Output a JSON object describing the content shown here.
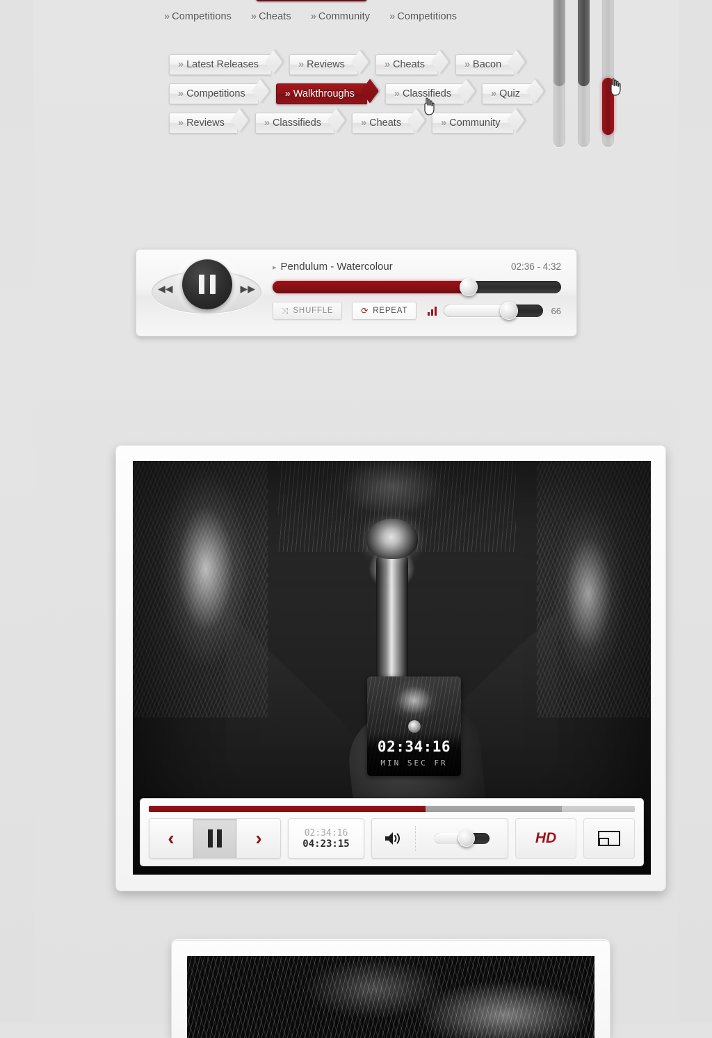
{
  "nav": {
    "breadcrumbs": [
      {
        "chev": "»",
        "label": "Competitions"
      },
      {
        "chev": "»",
        "label": "Cheats"
      },
      {
        "chev": "»",
        "label": "Community"
      },
      {
        "chev": "»",
        "label": "Competitions"
      }
    ],
    "tab_rows": [
      [
        {
          "chev": "»",
          "label": "Latest Releases",
          "active": false
        },
        {
          "chev": "»",
          "label": "Reviews",
          "active": false
        },
        {
          "chev": "»",
          "label": "Cheats",
          "active": false
        },
        {
          "chev": "»",
          "label": "Bacon",
          "active": false
        }
      ],
      [
        {
          "chev": "»",
          "label": "Competitions",
          "active": false
        },
        {
          "chev": "»",
          "label": "Walkthroughs",
          "active": true
        },
        {
          "chev": "»",
          "label": "Classifieds",
          "active": false
        },
        {
          "chev": "»",
          "label": "Quiz",
          "active": false
        }
      ],
      [
        {
          "chev": "»",
          "label": "Reviews",
          "active": false
        },
        {
          "chev": "»",
          "label": "Classifieds",
          "active": false
        },
        {
          "chev": "»",
          "label": "Cheats",
          "active": false
        },
        {
          "chev": "»",
          "label": "Community",
          "active": false
        }
      ]
    ]
  },
  "sliders": {
    "accent_color": "#9c1419",
    "items": [
      {
        "name": "slider-light",
        "fill_percent": 62,
        "style": "light"
      },
      {
        "name": "slider-dark",
        "fill_percent": 62,
        "style": "dark"
      },
      {
        "name": "slider-red",
        "fill_percent": 38,
        "style": "red"
      }
    ]
  },
  "audio_player": {
    "track_title": "Pendulum - Watercolour",
    "title_marker": "▸",
    "time_display": "02:36 - 4:32",
    "progress_percent": 68,
    "prev_icon": "◀◀",
    "next_icon": "▶▶",
    "state": "paused",
    "shuffle": {
      "label": "SHUFFLE",
      "icon": "⤨",
      "enabled": false
    },
    "repeat": {
      "label": "REPEAT",
      "icon": "⟳",
      "enabled": true
    },
    "volume_value": "66",
    "volume_percent": 66
  },
  "video_player": {
    "scrub_preview": {
      "timecode": "02:34:16",
      "units": "MIN SEC FR"
    },
    "progress": {
      "played_percent": 57,
      "buffered_percent": 85
    },
    "controls": {
      "prev_label": "‹",
      "pause_state": "paused",
      "next_label": "›",
      "current_time": "02:34:16",
      "duration": "04:23:15",
      "volume_percent": 58,
      "hd_label": "HD",
      "pip_name": "picture-in-picture"
    }
  },
  "colors": {
    "accent_red": "#9c1419",
    "dark_red": "#7c1015",
    "page_bg": "#e3e3e3",
    "panel_bg": "#fbfbfb"
  }
}
